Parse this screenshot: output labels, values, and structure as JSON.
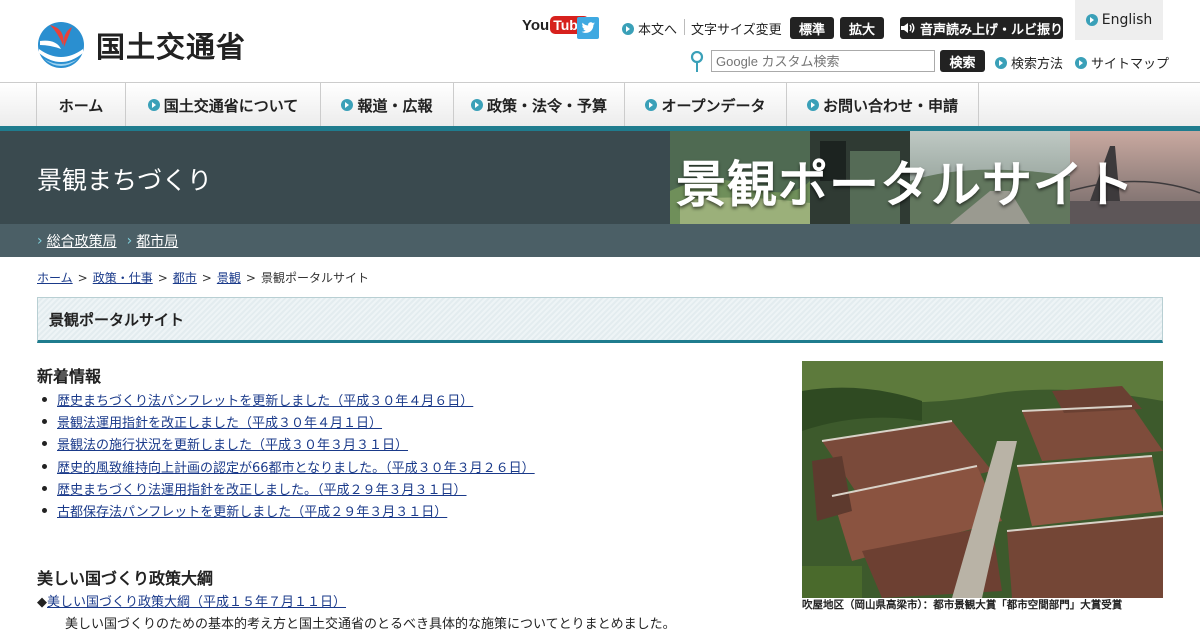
{
  "header": {
    "logo_text": "国土交通省",
    "youtube": {
      "you": "You",
      "tube": "Tube"
    },
    "honbun_link": "本文へ",
    "font_size_label": "文字サイズ変更",
    "font_standard_btn": "標準",
    "font_large_btn": "拡大",
    "speech_btn": "音声読み上げ・ルビ振り",
    "english_link": "English",
    "search_placeholder": "Google カスタム検索",
    "search_btn": "検索",
    "search_method_link": "検索方法",
    "sitemap_link": "サイトマップ"
  },
  "gnav": [
    "ホーム",
    "国土交通省について",
    "報道・広報",
    "政策・法令・予算",
    "オープンデータ",
    "お問い合わせ・申請"
  ],
  "banner": {
    "title": "景観まちづくり",
    "photo_text": "景観ポータルサイト"
  },
  "subnav": [
    "総合政策局",
    "都市局"
  ],
  "breadcrumb": {
    "items": [
      "ホーム",
      "政策・仕事",
      "都市",
      "景観"
    ],
    "current": "景観ポータルサイト",
    "separator": ">"
  },
  "page_title": "景観ポータルサイト",
  "news": {
    "heading": "新着情報",
    "items": [
      "歴史まちづくり法パンフレットを更新しました（平成３０年４月６日）",
      "景観法運用指針を改正しました（平成３０年４月１日）",
      "景観法の施行状況を更新しました（平成３０年３月３１日）",
      "歴史的風致維持向上計画の認定が66都市となりました。（平成３０年３月２６日）",
      "歴史まちづくり法運用指針を改正しました。（平成２９年３月３１日）",
      "古都保存法パンフレットを更新しました（平成２９年３月３１日）"
    ]
  },
  "policy": {
    "heading": "美しい国づくり政策大綱",
    "bullet": "◆",
    "link": "美しい国づくり政策大綱（平成１５年７月１１日）",
    "desc": "美しい国づくりのための基本的考え方と国土交通省のとるべき具体的な施策についてとりまとめました。"
  },
  "photo": {
    "caption": "吹屋地区（岡山県高梁市）：都市景観大賞「都市空間部門」大賞受賞"
  },
  "colors": {
    "teal": "#1f7c8e",
    "banner_bg": "#3a4a4f",
    "subbar_bg": "#4b5f66",
    "link": "#1a3a8a"
  }
}
